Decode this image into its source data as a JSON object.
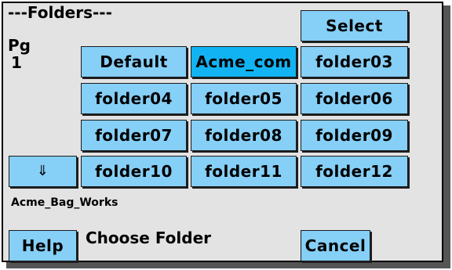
{
  "header": {
    "title": "---Folders---",
    "page_label": "Pg",
    "page_number": "1"
  },
  "actions": {
    "select_label": "Select",
    "scroll_down_glyph": "⇓",
    "help_label": "Help",
    "cancel_label": "Cancel"
  },
  "folders": [
    {
      "label": "Default",
      "selected": false
    },
    {
      "label": "Acme_com",
      "selected": true
    },
    {
      "label": "folder03",
      "selected": false
    },
    {
      "label": "folder04",
      "selected": false
    },
    {
      "label": "folder05",
      "selected": false
    },
    {
      "label": "folder06",
      "selected": false
    },
    {
      "label": "folder07",
      "selected": false
    },
    {
      "label": "folder08",
      "selected": false
    },
    {
      "label": "folder09",
      "selected": false
    },
    {
      "label": "folder10",
      "selected": false
    },
    {
      "label": "folder11",
      "selected": false
    },
    {
      "label": "folder12",
      "selected": false
    }
  ],
  "status": {
    "current_name": "Acme_Bag_Works",
    "prompt": "Choose Folder"
  },
  "colors": {
    "button": "#86cff7",
    "button_selected": "#12b3f3",
    "panel": "#e3e3e3"
  }
}
